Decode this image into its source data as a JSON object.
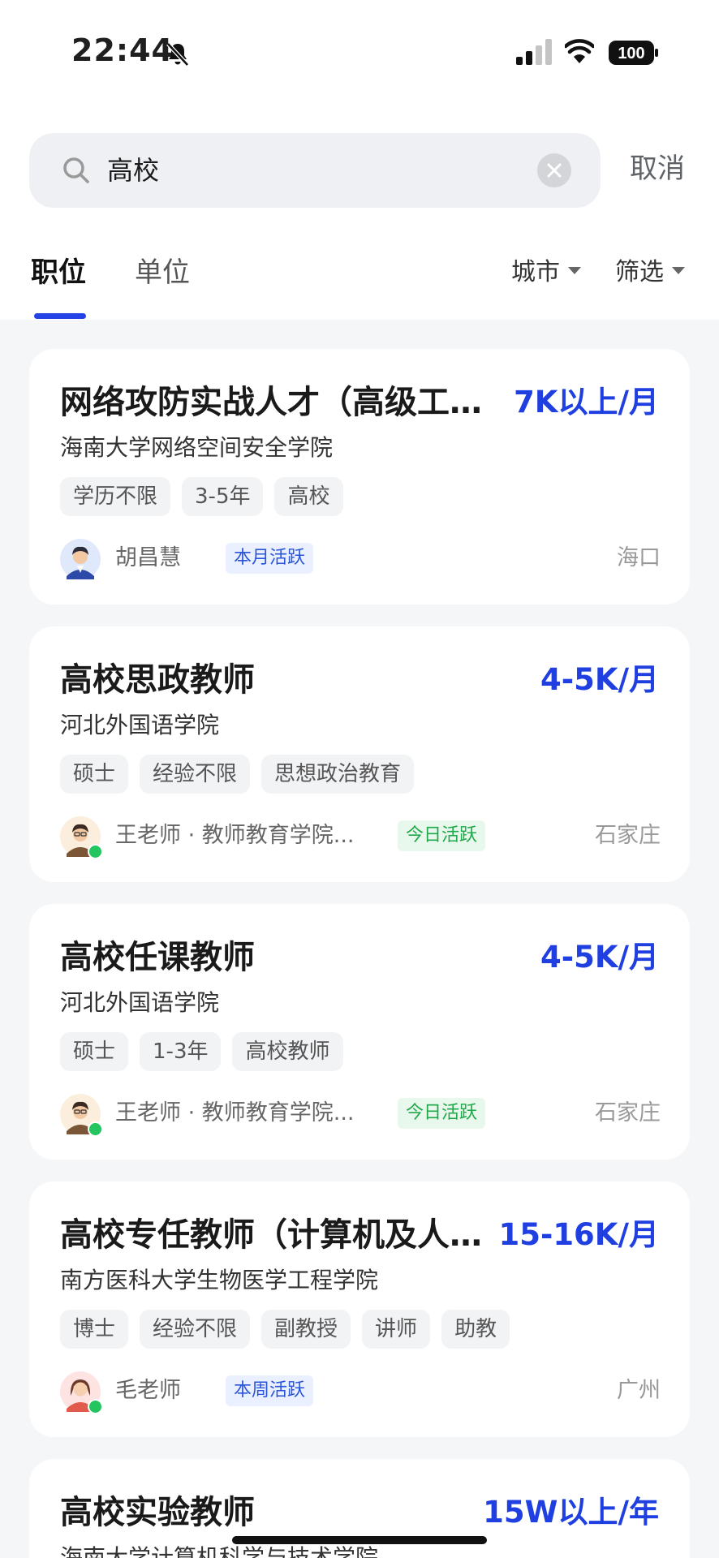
{
  "status_bar": {
    "time": "22:44",
    "battery": "100"
  },
  "search": {
    "query": "高校",
    "cancel_label": "取消"
  },
  "tabs": [
    {
      "label": "职位",
      "active": true
    },
    {
      "label": "单位",
      "active": false
    }
  ],
  "filters": {
    "city": "城市",
    "more": "筛选"
  },
  "colors": {
    "accent": "#1f3fe0",
    "tab_indicator": "#2343e6",
    "active_green": "#20a84a",
    "active_blue": "#2a55d8"
  },
  "jobs": [
    {
      "title": "网络攻防实战人才（高级工程师）",
      "salary": "7K以上/月",
      "org": "海南大学网络空间安全学院",
      "tags": [
        "学历不限",
        "3-5年",
        "高校"
      ],
      "recruiter": "胡昌慧",
      "activity": "本月活跃",
      "location": "海口"
    },
    {
      "title": "高校思政教师",
      "salary": "4-5K/月",
      "org": "河北外国语学院",
      "tags": [
        "硕士",
        "经验不限",
        "思想政治教育"
      ],
      "recruiter": "王老师 · 教师教育学院...",
      "activity": "今日活跃",
      "location": "石家庄"
    },
    {
      "title": "高校任课教师",
      "salary": "4-5K/月",
      "org": "河北外国语学院",
      "tags": [
        "硕士",
        "1-3年",
        "高校教师"
      ],
      "recruiter": "王老师 · 教师教育学院...",
      "activity": "今日活跃",
      "location": "石家庄"
    },
    {
      "title": "高校专任教师（计算机及人工智能）",
      "salary": "15-16K/月",
      "org": "南方医科大学生物医学工程学院",
      "tags": [
        "博士",
        "经验不限",
        "副教授",
        "讲师",
        "助教"
      ],
      "recruiter": "毛老师",
      "activity": "本周活跃",
      "location": "广州"
    },
    {
      "title": "高校实验教师",
      "salary": "15W以上/年",
      "org": "海南大学计算机科学与技术学院"
    }
  ]
}
